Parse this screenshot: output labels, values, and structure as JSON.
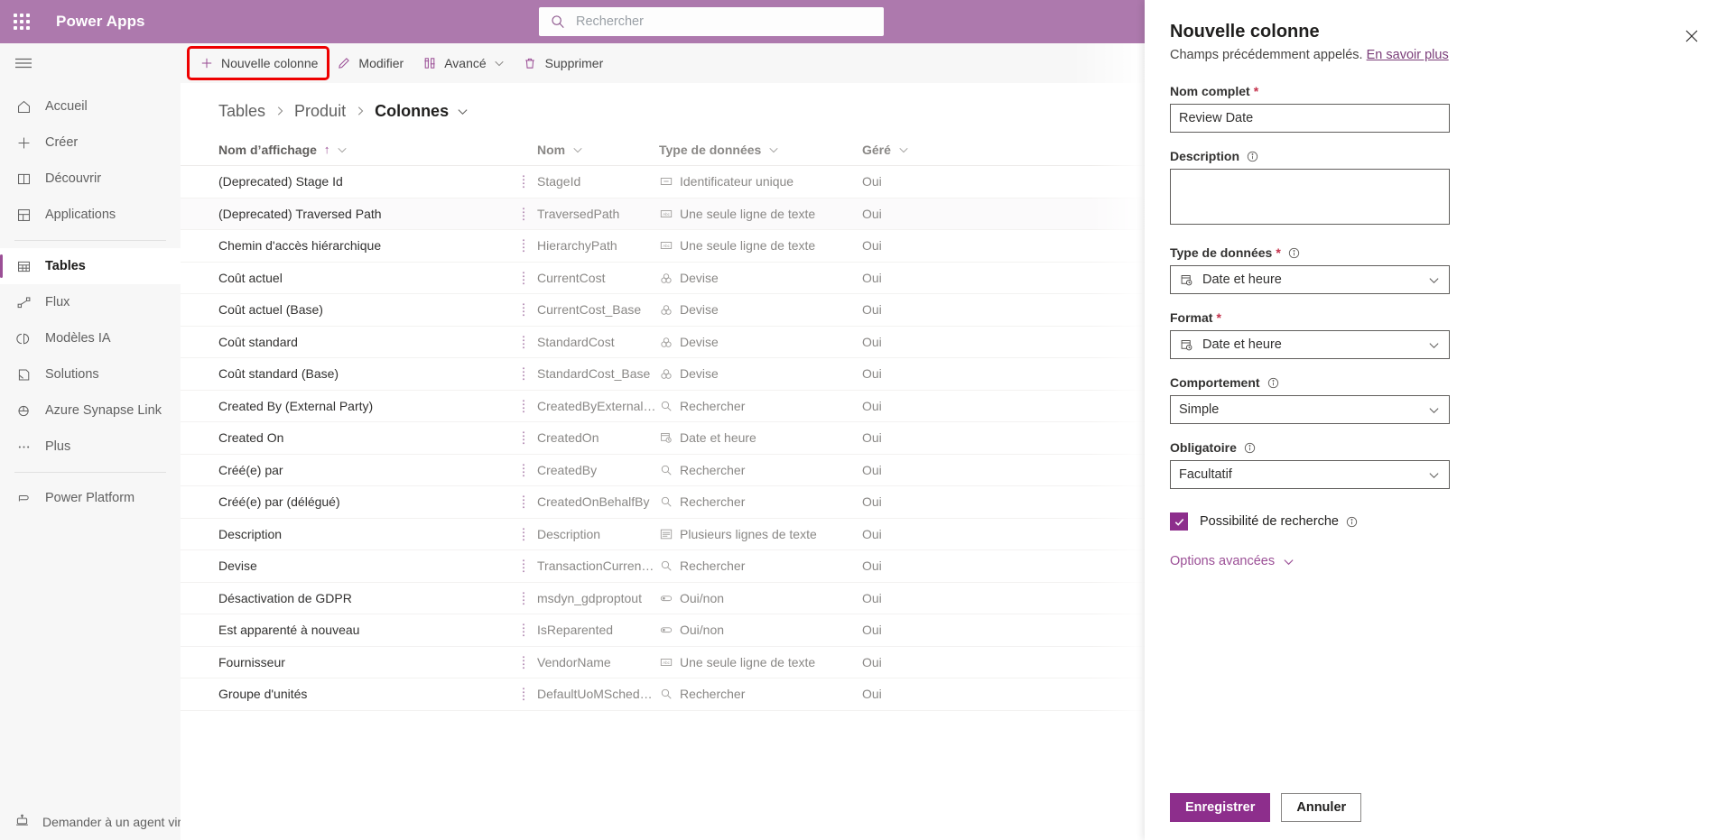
{
  "header": {
    "brand": "Power Apps",
    "waffle_icon": "app-launcher-icon",
    "search": {
      "placeholder": "Rechercher",
      "icon": "search-icon"
    }
  },
  "sidebar": {
    "hamburger_icon": "hamburger-icon",
    "items": [
      {
        "label": "Accueil",
        "icon": "home-icon",
        "active": false
      },
      {
        "label": "Créer",
        "icon": "plus-icon",
        "active": false
      },
      {
        "label": "Découvrir",
        "icon": "book-icon",
        "active": false
      },
      {
        "label": "Applications",
        "icon": "apps-grid-icon",
        "active": false
      },
      {
        "label": "Tables",
        "icon": "table-icon",
        "active": true
      },
      {
        "label": "Flux",
        "icon": "flow-icon",
        "active": false
      },
      {
        "label": "Modèles IA",
        "icon": "ai-brain-icon",
        "active": false
      },
      {
        "label": "Solutions",
        "icon": "solutions-icon",
        "active": false
      },
      {
        "label": "Azure Synapse Link",
        "icon": "synapse-icon",
        "active": false
      },
      {
        "label": "Plus",
        "icon": "ellipsis-icon",
        "active": false
      },
      {
        "label": "Power Platform",
        "icon": "power-platform-icon",
        "active": false
      }
    ],
    "bottom": {
      "label": "Demander à un agent virt",
      "icon": "virtual-agent-icon"
    }
  },
  "commandbar": {
    "buttons": [
      {
        "label": "Nouvelle colonne",
        "icon": "plus-icon",
        "highlighted": true,
        "chevron": false
      },
      {
        "label": "Modifier",
        "icon": "pencil-icon",
        "highlighted": false,
        "chevron": false
      },
      {
        "label": "Avancé",
        "icon": "advanced-icon",
        "highlighted": false,
        "chevron": true
      },
      {
        "label": "Supprimer",
        "icon": "trash-icon",
        "highlighted": false,
        "chevron": false
      }
    ]
  },
  "breadcrumb": {
    "items": [
      "Tables",
      "Produit",
      "Colonnes"
    ],
    "chevron_icon": "chevron-down-icon"
  },
  "grid": {
    "columns": [
      {
        "label": "Nom d’affichage",
        "sorted": true,
        "sort_arrow": "↑"
      },
      {
        "label": "Nom",
        "sorted": false
      },
      {
        "label": "Type de données",
        "sorted": false
      },
      {
        "label": "Géré",
        "sorted": false
      }
    ],
    "rows": [
      {
        "display": "(Deprecated) Stage Id",
        "name": "StageId",
        "type": "Identificateur unique",
        "type_icon": "unique-id-icon",
        "managed": "Oui"
      },
      {
        "display": "(Deprecated) Traversed Path",
        "name": "TraversedPath",
        "type": "Une seule ligne de texte",
        "type_icon": "text-icon",
        "managed": "Oui"
      },
      {
        "display": "Chemin d'accès hiérarchique",
        "name": "HierarchyPath",
        "type": "Une seule ligne de texte",
        "type_icon": "text-icon",
        "managed": "Oui"
      },
      {
        "display": "Coût actuel",
        "name": "CurrentCost",
        "type": "Devise",
        "type_icon": "currency-icon",
        "managed": "Oui"
      },
      {
        "display": "Coût actuel (Base)",
        "name": "CurrentCost_Base",
        "type": "Devise",
        "type_icon": "currency-icon",
        "managed": "Oui"
      },
      {
        "display": "Coût standard",
        "name": "StandardCost",
        "type": "Devise",
        "type_icon": "currency-icon",
        "managed": "Oui"
      },
      {
        "display": "Coût standard (Base)",
        "name": "StandardCost_Base",
        "type": "Devise",
        "type_icon": "currency-icon",
        "managed": "Oui"
      },
      {
        "display": "Created By (External Party)",
        "name": "CreatedByExternalParty",
        "type": "Rechercher",
        "type_icon": "lookup-icon",
        "managed": "Oui"
      },
      {
        "display": "Created On",
        "name": "CreatedOn",
        "type": "Date et heure",
        "type_icon": "datetime-icon",
        "managed": "Oui"
      },
      {
        "display": "Créé(e) par",
        "name": "CreatedBy",
        "type": "Rechercher",
        "type_icon": "lookup-icon",
        "managed": "Oui"
      },
      {
        "display": "Créé(e) par (délégué)",
        "name": "CreatedOnBehalfBy",
        "type": "Rechercher",
        "type_icon": "lookup-icon",
        "managed": "Oui"
      },
      {
        "display": "Description",
        "name": "Description",
        "type": "Plusieurs lignes de texte",
        "type_icon": "multiline-text-icon",
        "managed": "Oui"
      },
      {
        "display": "Devise",
        "name": "TransactionCurrencyId",
        "type": "Rechercher",
        "type_icon": "lookup-icon",
        "managed": "Oui"
      },
      {
        "display": "Désactivation de GDPR",
        "name": "msdyn_gdproptout",
        "type": "Oui/non",
        "type_icon": "toggle-icon",
        "managed": "Oui"
      },
      {
        "display": "Est apparenté à nouveau",
        "name": "IsReparented",
        "type": "Oui/non",
        "type_icon": "toggle-icon",
        "managed": "Oui"
      },
      {
        "display": "Fournisseur",
        "name": "VendorName",
        "type": "Une seule ligne de texte",
        "type_icon": "text-icon",
        "managed": "Oui"
      },
      {
        "display": "Groupe d'unités",
        "name": "DefaultUoMScheduleId",
        "type": "Rechercher",
        "type_icon": "lookup-icon",
        "managed": "Oui"
      }
    ]
  },
  "panel": {
    "title": "Nouvelle colonne",
    "subtitle_text": "Champs précédemment appelés.",
    "subtitle_link": "En savoir plus",
    "close_icon": "close-icon",
    "fields": {
      "display_name": {
        "label": "Nom complet",
        "required": "*",
        "value": "Review Date"
      },
      "description": {
        "label": "Description",
        "value": "",
        "info_icon": "info-icon"
      },
      "data_type": {
        "label": "Type de données",
        "required": "*",
        "value": "Date et heure",
        "icon": "datetime-icon",
        "info_icon": "info-icon"
      },
      "format": {
        "label": "Format",
        "required": "*",
        "value": "Date et heure",
        "icon": "datetime-icon"
      },
      "behavior": {
        "label": "Comportement",
        "value": "Simple",
        "info_icon": "info-icon"
      },
      "required_field": {
        "label": "Obligatoire",
        "value": "Facultatif",
        "info_icon": "info-icon"
      },
      "searchable": {
        "label": "Possibilité de recherche",
        "checked": true,
        "info_icon": "info-icon"
      },
      "advanced": {
        "label": "Options avancées",
        "chevron_icon": "chevron-down-icon"
      }
    },
    "footer": {
      "save_label": "Enregistrer",
      "cancel_label": "Annuler"
    }
  },
  "colors": {
    "brand_purple": "#ad79ad",
    "accent_purple": "#9b4f96",
    "primary_button": "#8d2e8c",
    "highlight_red": "#ee0000",
    "required_red": "#c4314b"
  }
}
